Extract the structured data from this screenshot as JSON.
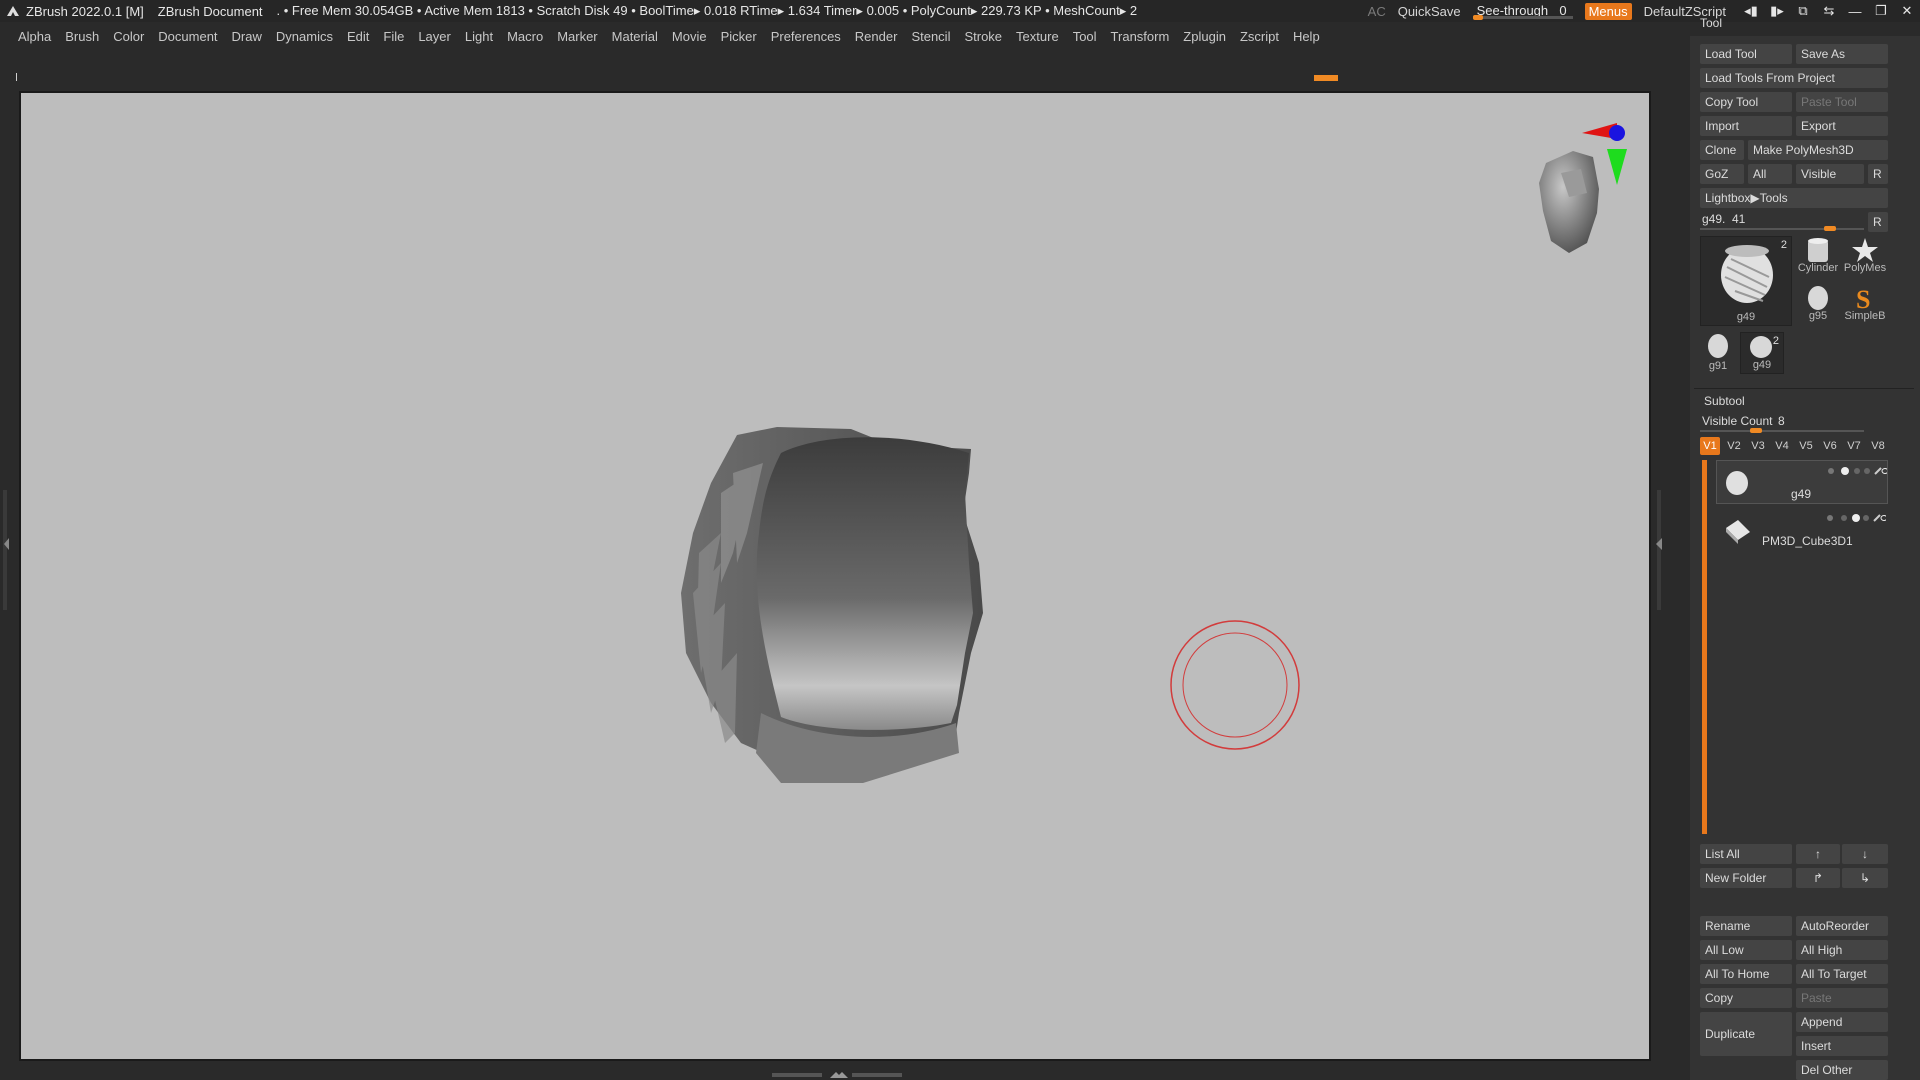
{
  "titlebar": {
    "app": "ZBrush 2022.0.1 [M]",
    "document": "ZBrush Document",
    "stats": ". • Free Mem 30.054GB • Active Mem 1813 • Scratch Disk 49 •  BoolTime▸ 0.018 RTime▸ 1.634 Timer▸ 0.005 • PolyCount▸ 229.73 KP  • MeshCount▸ 2",
    "ac": "AC",
    "quicksave": "QuickSave",
    "seethrough_label": "See-through",
    "seethrough_value": "0",
    "seethrough_level": 0,
    "menus": "Menus",
    "zscript": "DefaultZScript"
  },
  "menubar": [
    "Alpha",
    "Brush",
    "Color",
    "Document",
    "Draw",
    "Dynamics",
    "Edit",
    "File",
    "Layer",
    "Light",
    "Macro",
    "Marker",
    "Material",
    "Movie",
    "Picker",
    "Preferences",
    "Render",
    "Stencil",
    "Stroke",
    "Texture",
    "Tool",
    "Transform",
    "Zplugin",
    "Zscript",
    "Help"
  ],
  "tool_panel": {
    "title": "Tool",
    "load_tool": "Load Tool",
    "save_as": "Save As",
    "load_from_project": "Load Tools From Project",
    "copy_tool": "Copy Tool",
    "paste_tool": "Paste Tool",
    "import": "Import",
    "export": "Export",
    "clone": "Clone",
    "make_polymesh": "Make PolyMesh3D",
    "goz": "GoZ",
    "all": "All",
    "visible": "Visible",
    "r": "R",
    "lightbox": "Lightbox▶Tools",
    "slider_label": "g49.",
    "slider_value": "41",
    "thumbs": {
      "main": "g49",
      "main_badge": "2",
      "cylinder": "Cylinder",
      "polymesh": "PolyMes",
      "g95": "g95",
      "simpleb": "SimpleB",
      "g91": "g91",
      "g49_small": "g49",
      "g49_small_badge": "2"
    }
  },
  "subtool": {
    "title": "Subtool",
    "visible_count_label": "Visible Count",
    "visible_count": "8",
    "tabs": [
      "V1",
      "V2",
      "V3",
      "V4",
      "V5",
      "V6",
      "V7",
      "V8"
    ],
    "items": [
      {
        "name": "g49"
      },
      {
        "name": "PM3D_Cube3D1"
      }
    ],
    "list_all": "List All",
    "new_folder": "New Folder",
    "rename": "Rename",
    "autoreorder": "AutoReorder",
    "all_low": "All Low",
    "all_high": "All High",
    "all_to_home": "All To Home",
    "all_to_target": "All To Target",
    "copy": "Copy",
    "paste": "Paste",
    "duplicate": "Duplicate",
    "append": "Append",
    "insert": "Insert",
    "del_other": "Del Other"
  },
  "colors": {
    "accent": "#E8781C",
    "viewport_bg": "#BDBDBD",
    "brush_ring": "#D23C3C"
  }
}
